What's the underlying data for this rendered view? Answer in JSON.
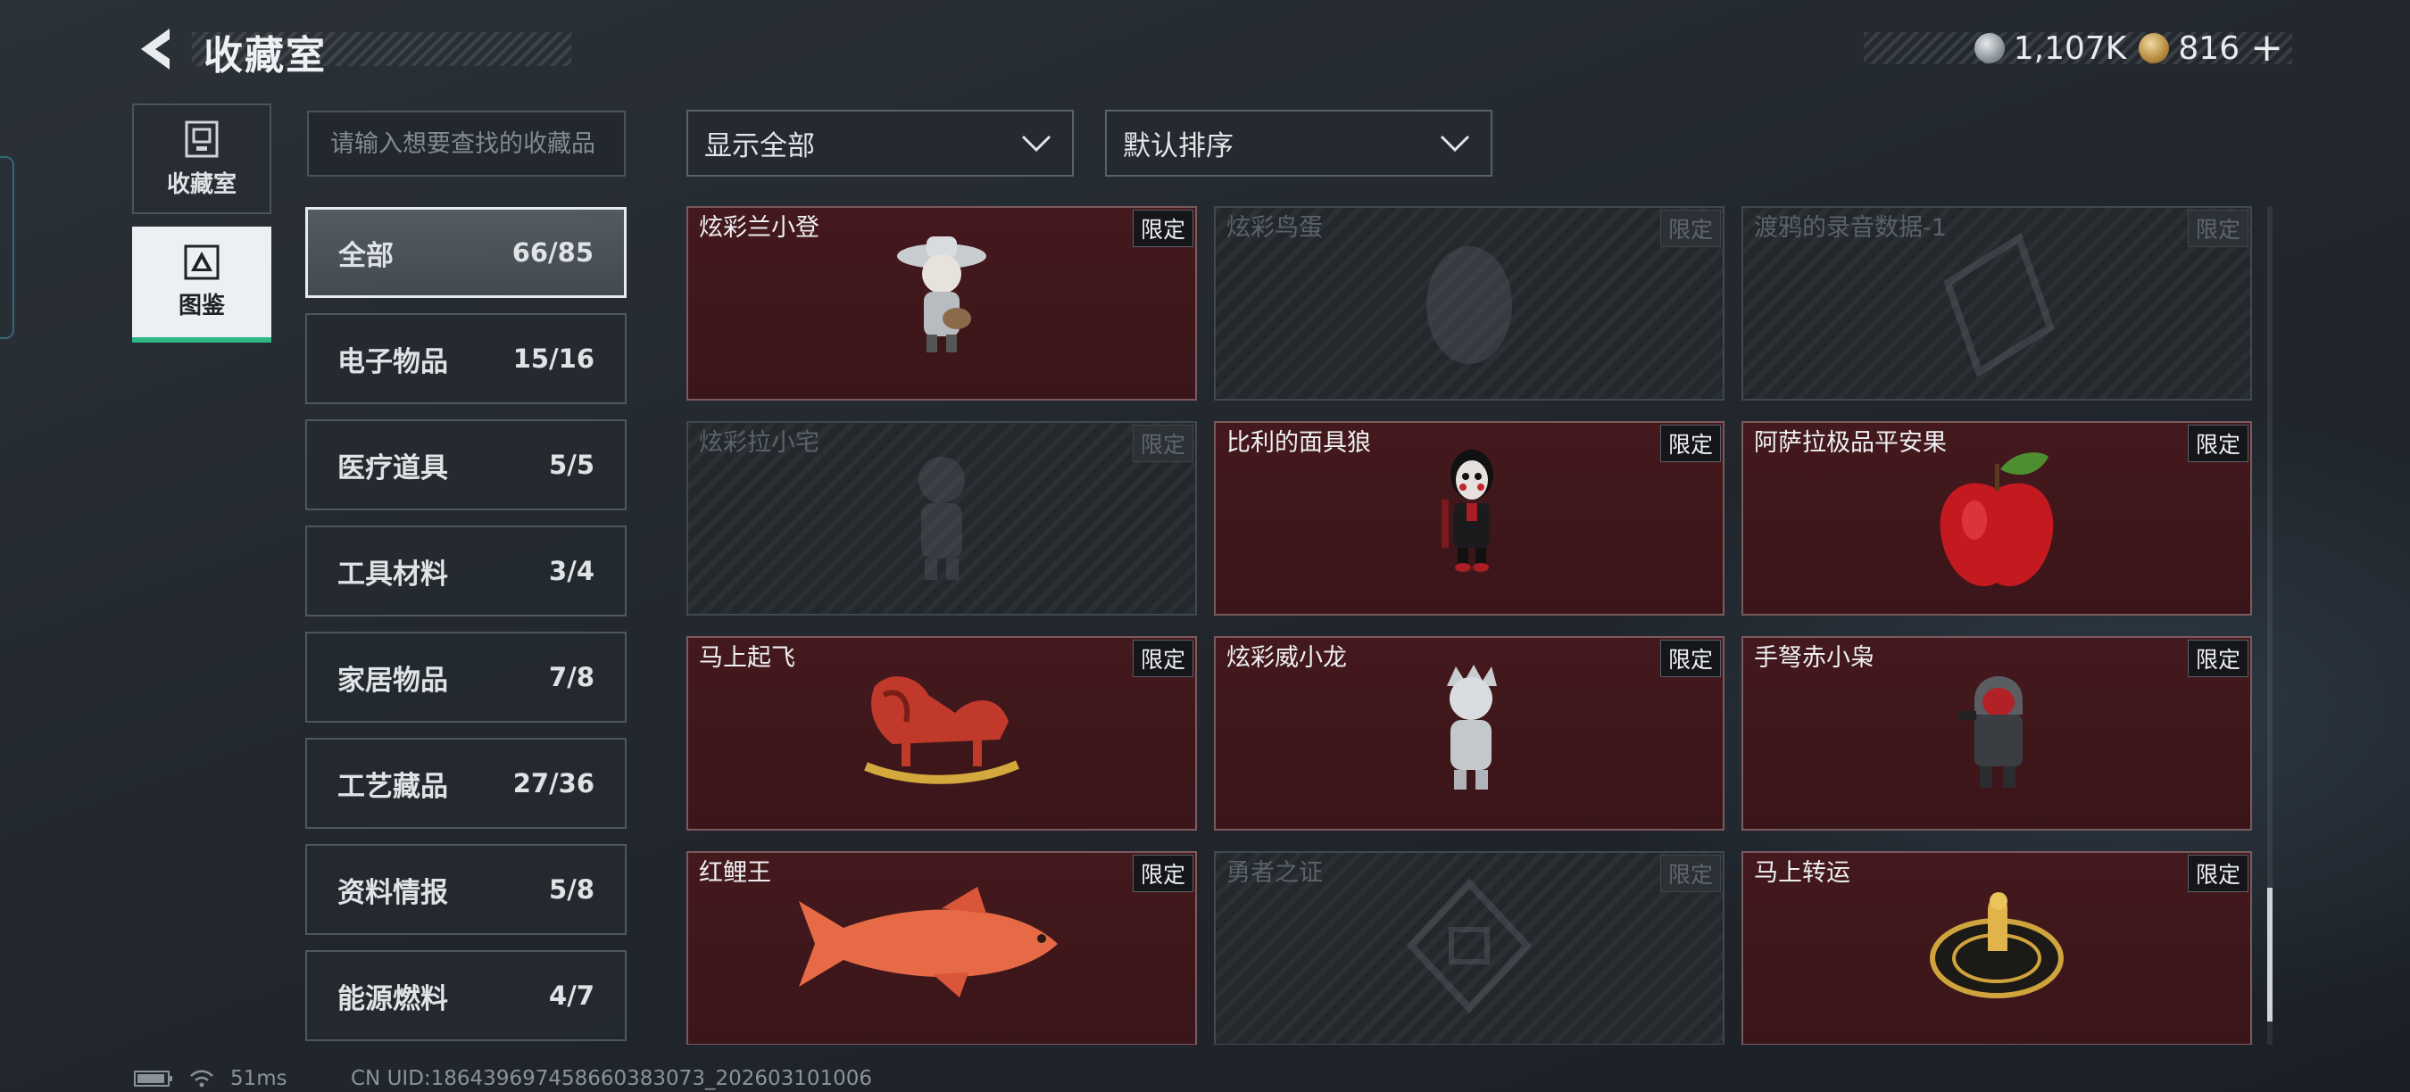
{
  "header": {
    "title": "收藏室",
    "currency": [
      {
        "icon": "silver-coin-icon",
        "value": "1,107K"
      },
      {
        "icon": "gold-coin-icon",
        "value": "816"
      }
    ],
    "add_label": "+"
  },
  "modes": [
    {
      "label": "收藏室",
      "icon": "collection-room-icon",
      "active": false
    },
    {
      "label": "图鉴",
      "icon": "codex-icon",
      "active": true
    }
  ],
  "search": {
    "placeholder": "请输入想要查找的收藏品",
    "value": ""
  },
  "categories": [
    {
      "name": "全部",
      "count": "66/85",
      "active": true
    },
    {
      "name": "电子物品",
      "count": "15/16"
    },
    {
      "name": "医疗道具",
      "count": "5/5"
    },
    {
      "name": "工具材料",
      "count": "3/4"
    },
    {
      "name": "家居物品",
      "count": "7/8"
    },
    {
      "name": "工艺藏品",
      "count": "27/36"
    },
    {
      "name": "资料情报",
      "count": "5/8"
    },
    {
      "name": "能源燃料",
      "count": "4/7"
    }
  ],
  "filters": {
    "display": "显示全部",
    "sort": "默认排序"
  },
  "items": [
    {
      "name": "炫彩兰小登",
      "badge": "限定",
      "owned": true,
      "art": "doll"
    },
    {
      "name": "炫彩鸟蛋",
      "badge": "限定",
      "owned": false,
      "art": "egg"
    },
    {
      "name": "渡鸦的录音数据-1",
      "badge": "限定",
      "owned": false,
      "art": "card"
    },
    {
      "name": "炫彩拉小宅",
      "badge": "限定",
      "owned": false,
      "art": "doll"
    },
    {
      "name": "比利的面具狼",
      "badge": "限定",
      "owned": true,
      "art": "puppet"
    },
    {
      "name": "阿萨拉极品平安果",
      "badge": "限定",
      "owned": true,
      "art": "apple"
    },
    {
      "name": "马上起飞",
      "badge": "限定",
      "owned": true,
      "art": "horse"
    },
    {
      "name": "炫彩威小龙",
      "badge": "限定",
      "owned": true,
      "art": "doll-white"
    },
    {
      "name": "手弩赤小枭",
      "badge": "限定",
      "owned": true,
      "art": "hooded"
    },
    {
      "name": "红鲤王",
      "badge": "限定",
      "owned": true,
      "art": "fish"
    },
    {
      "name": "勇者之证",
      "badge": "限定",
      "owned": false,
      "art": "card"
    },
    {
      "name": "马上转运",
      "badge": "限定",
      "owned": true,
      "art": "disc"
    }
  ],
  "footer": {
    "ping": "51ms",
    "uid": "CN UID:1864396974586603830​73_202603101006"
  },
  "colors": {
    "accent_green": "#2fb886",
    "owned_card": "#44191d",
    "locked_card": "#23282d"
  }
}
